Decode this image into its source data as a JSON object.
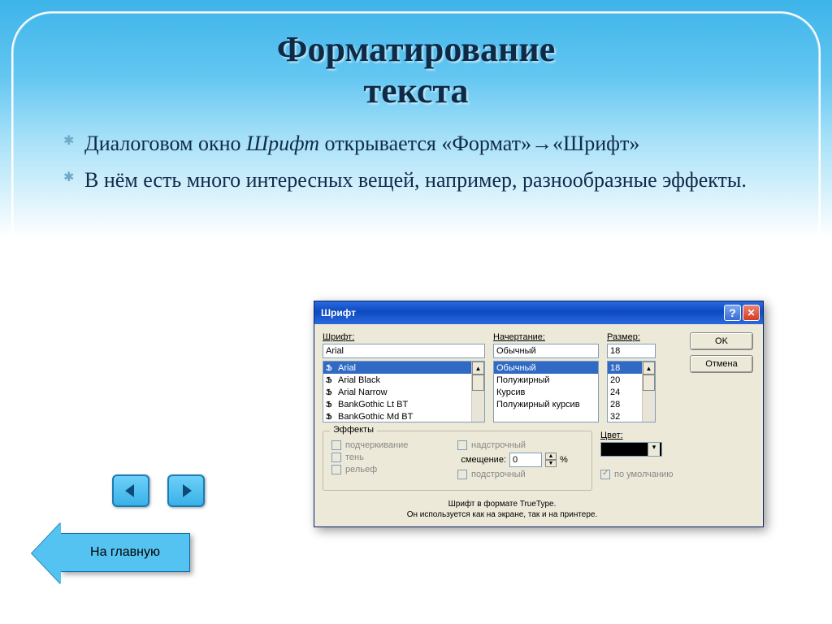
{
  "slide": {
    "title_line1": "Форматирование",
    "title_line2": "текста",
    "bullet1_prefix": "Диалоговом окно ",
    "bullet1_italic": "Шрифт",
    "bullet1_suffix": " открывается «Формат»→«Шрифт»",
    "bullet2": "В нём есть много интересных вещей, например, разнообразные эффекты.",
    "home_label": "На главную"
  },
  "dialog": {
    "title": "Шрифт",
    "ok": "OK",
    "cancel": "Отмена",
    "font_label": "Шрифт:",
    "font_value": "Arial",
    "font_list": [
      "Arial",
      "Arial Black",
      "Arial Narrow",
      "BankGothic Lt BT",
      "BankGothic Md BT"
    ],
    "style_label": "Начертание:",
    "style_value": "Обычный",
    "style_list": [
      "Обычный",
      "Полужирный",
      "Курсив",
      "Полужирный курсив"
    ],
    "size_label": "Размер:",
    "size_value": "18",
    "size_list": [
      "18",
      "20",
      "24",
      "28",
      "32"
    ],
    "effects_label": "Эффекты",
    "chk_underline": "подчеркивание",
    "chk_shadow": "тень",
    "chk_relief": "рельеф",
    "chk_super": "надстрочный",
    "chk_sub": "подстрочный",
    "offset_label": "смещение:",
    "offset_value": "0",
    "offset_suffix": "%",
    "color_label": "Цвет:",
    "default_label": "по умолчанию",
    "footer1": "Шрифт в формате TrueType.",
    "footer2": "Он используется как на экране, так и на принтере."
  }
}
